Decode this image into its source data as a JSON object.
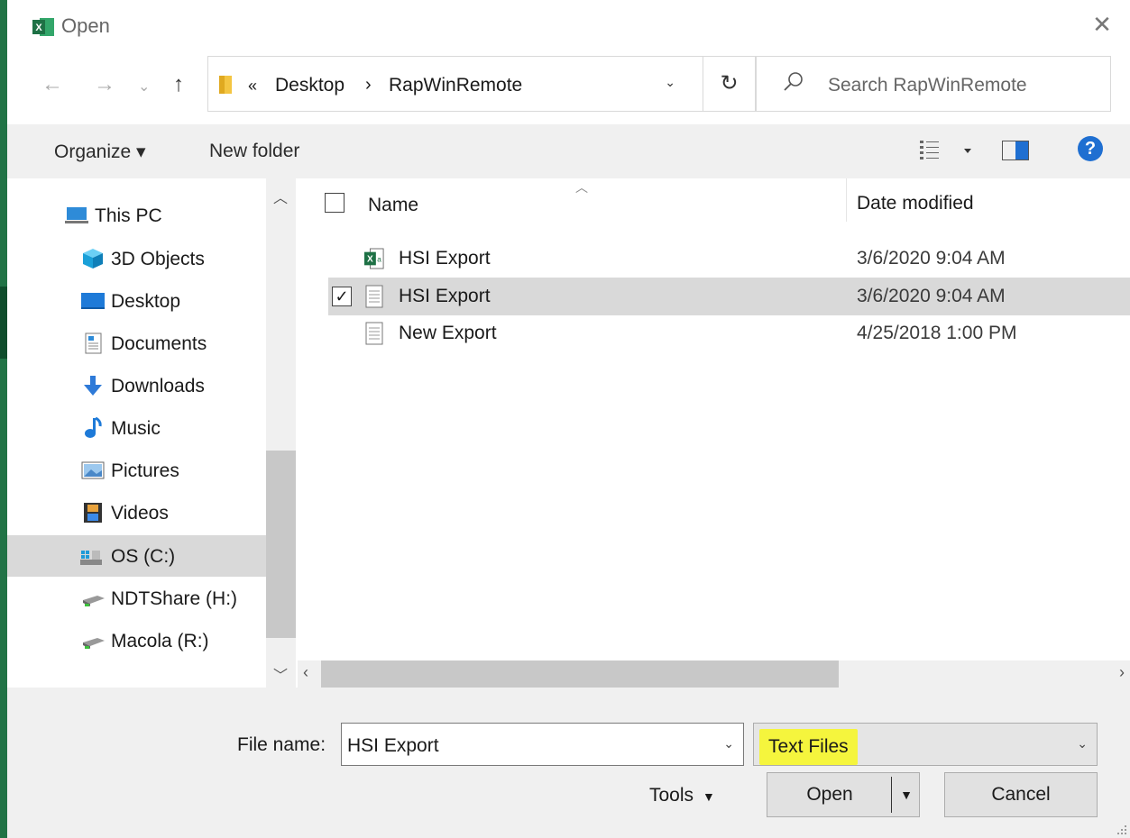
{
  "window": {
    "title": "Open"
  },
  "nav": {
    "back": "←",
    "forward": "→",
    "recent": "⌄",
    "up": "↑",
    "breadcrumb_overflow": "«",
    "breadcrumb": [
      "Desktop",
      "RapWinRemote"
    ],
    "breadcrumb_sep": "›",
    "refresh": "↻",
    "search_placeholder": "Search RapWinRemote"
  },
  "toolbar": {
    "organize": "Organize ▾",
    "new_folder": "New folder",
    "help": "?"
  },
  "sidebar": {
    "items": [
      {
        "label": "This PC",
        "icon": "computer-icon"
      },
      {
        "label": "3D Objects",
        "icon": "cube-icon"
      },
      {
        "label": "Desktop",
        "icon": "desktop-icon"
      },
      {
        "label": "Documents",
        "icon": "documents-icon"
      },
      {
        "label": "Downloads",
        "icon": "download-icon"
      },
      {
        "label": "Music",
        "icon": "music-icon"
      },
      {
        "label": "Pictures",
        "icon": "pictures-icon"
      },
      {
        "label": "Videos",
        "icon": "videos-icon"
      },
      {
        "label": "OS (C:)",
        "icon": "drive-icon"
      },
      {
        "label": "NDTShare (H:)",
        "icon": "network-drive-icon"
      },
      {
        "label": "Macola (R:)",
        "icon": "network-drive-icon"
      }
    ]
  },
  "files": {
    "columns": {
      "name": "Name",
      "date": "Date modified"
    },
    "rows": [
      {
        "name": "HSI Export",
        "date": "3/6/2020 9:04 AM",
        "icon": "excel-file-icon",
        "checked": false
      },
      {
        "name": "HSI Export",
        "date": "3/6/2020 9:04 AM",
        "icon": "text-file-icon",
        "checked": true
      },
      {
        "name": "New Export",
        "date": "4/25/2018 1:00 PM",
        "icon": "text-file-icon",
        "checked": false
      }
    ]
  },
  "bottom": {
    "file_name_label": "File name:",
    "file_name_value": "HSI Export",
    "file_type_value": "Text Files",
    "tools": "Tools",
    "open": "Open",
    "cancel": "Cancel"
  },
  "colors": {
    "accent": "#1f6fd1",
    "excel": "#217346",
    "highlight": "#f5f53d",
    "selection": "#d9d9d9"
  }
}
